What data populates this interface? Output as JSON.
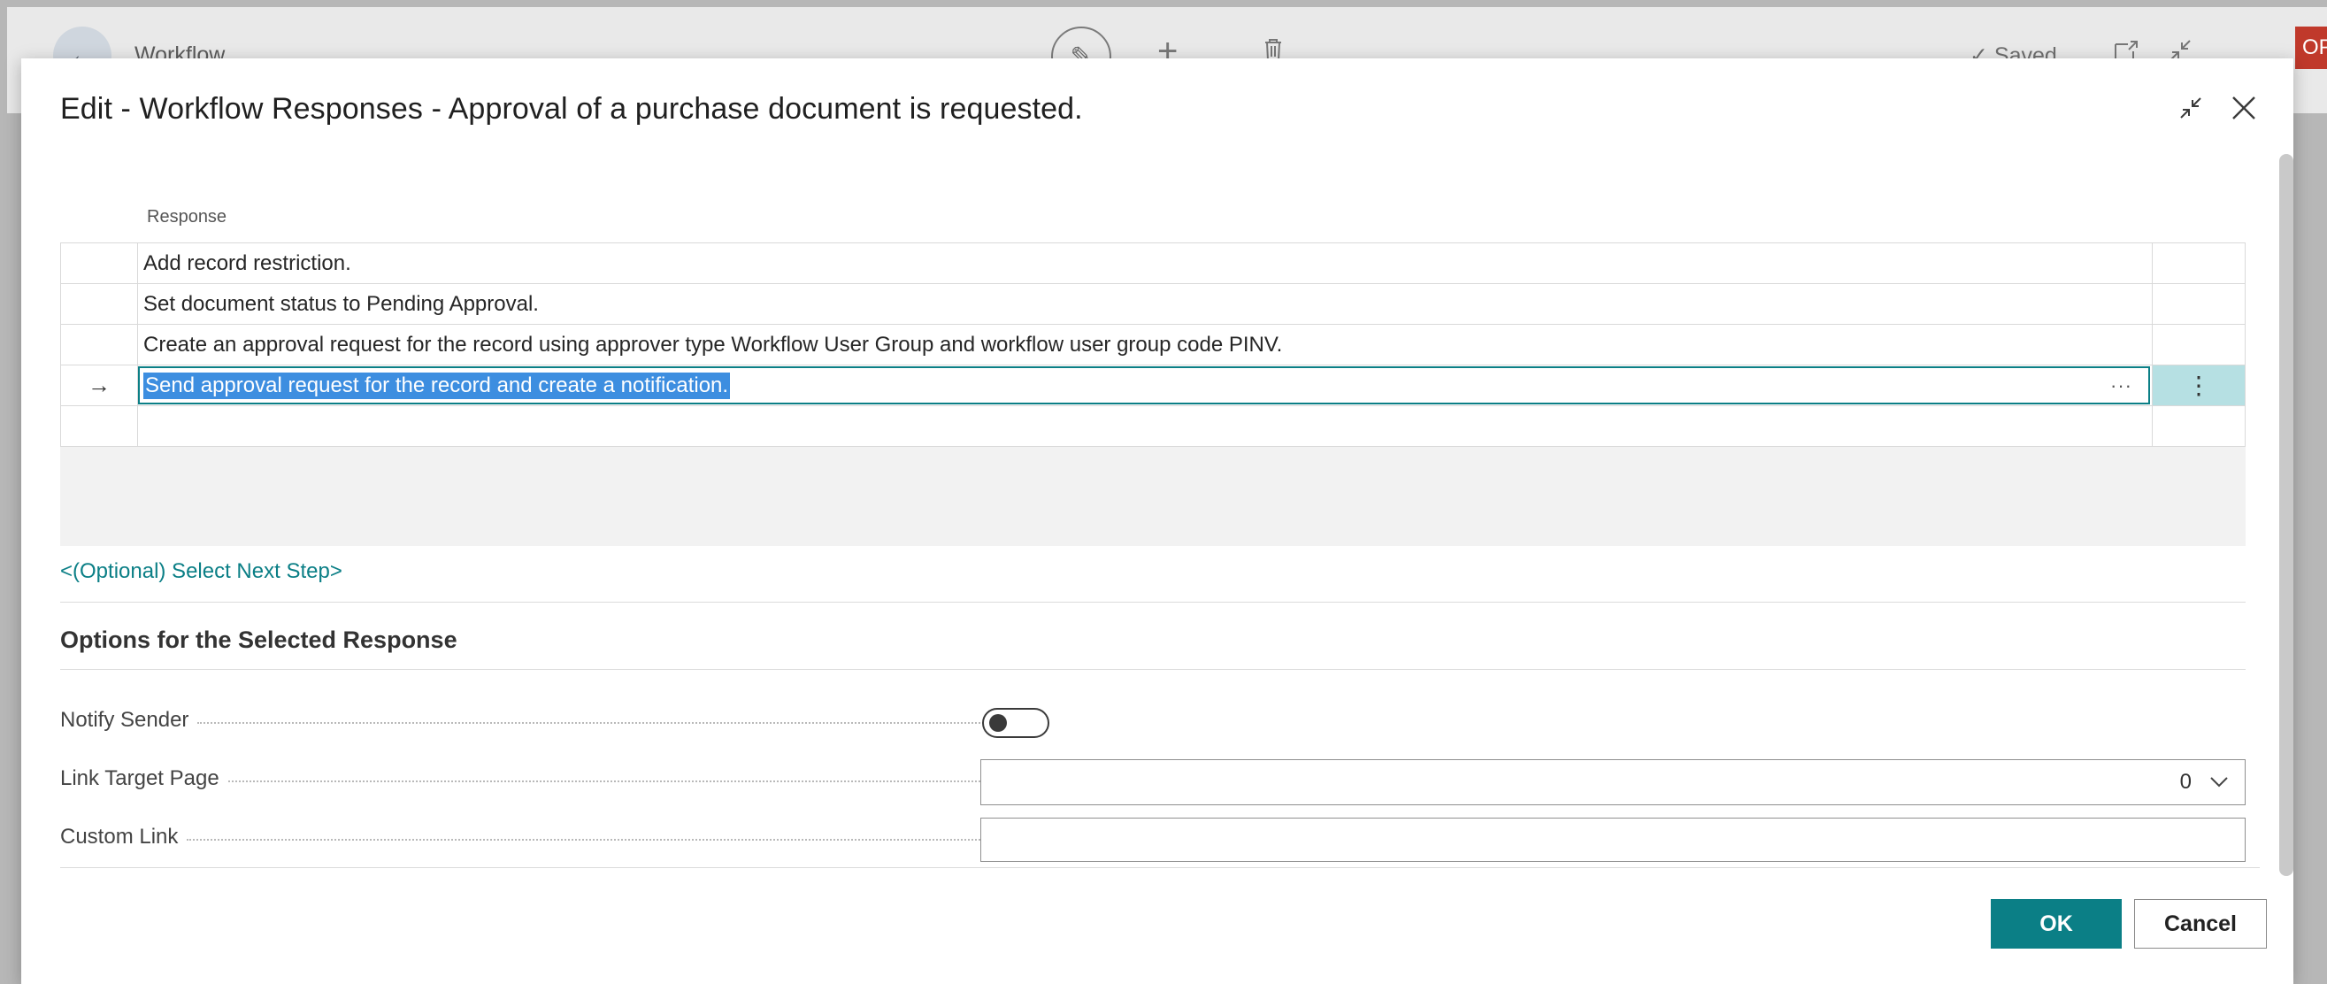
{
  "background": {
    "title": "Workflow",
    "saved_label": "Saved",
    "badge_label": "OP",
    "icons": [
      "back-arrow-icon",
      "pencil-icon",
      "plus-icon",
      "trash-icon",
      "checkmark-icon",
      "open-new-window-icon",
      "collapse-icon"
    ]
  },
  "dialog": {
    "title": "Edit - Workflow Responses - Approval of a purchase document is requested.",
    "icons": [
      "collapse-icon",
      "close-icon"
    ]
  },
  "grid": {
    "column_header": "Response",
    "rows": [
      {
        "text": "Add record restriction.",
        "selected": false,
        "indicator": ""
      },
      {
        "text": "Set document status to Pending Approval.",
        "selected": false,
        "indicator": ""
      },
      {
        "text": "Create an approval request for the record using approver type Workflow User Group and workflow user group code PINV.",
        "selected": false,
        "indicator": ""
      },
      {
        "text": "Send approval request for the record and create a notification.",
        "selected": true,
        "indicator": "→",
        "ellipsis": "···",
        "action": "⋮"
      },
      {
        "text": "",
        "selected": false,
        "indicator": ""
      }
    ]
  },
  "next_step_link": "<(Optional) Select Next Step>",
  "options": {
    "section_title": "Options for the Selected Response",
    "notify_sender": {
      "label": "Notify Sender",
      "value": false
    },
    "link_target_page": {
      "label": "Link Target Page",
      "value": "0"
    },
    "custom_link": {
      "label": "Custom Link",
      "value": ""
    }
  },
  "buttons": {
    "ok": "OK",
    "cancel": "Cancel"
  },
  "colors": {
    "accent": "#0b7f86",
    "selection": "#3d8ee0",
    "selected_action_bg": "#b6e0e3"
  }
}
